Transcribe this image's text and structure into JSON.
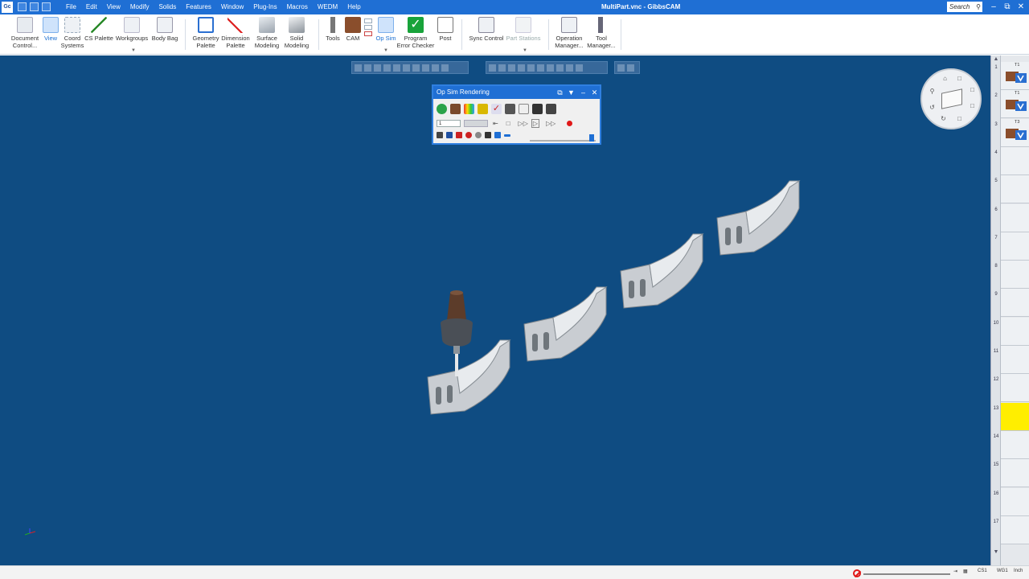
{
  "app": {
    "title": "MultiPart.vnc - GibbsCAM",
    "icon_label": "Gc",
    "search_placeholder": "Search"
  },
  "menu": [
    "File",
    "Edit",
    "View",
    "Modify",
    "Solids",
    "Features",
    "Window",
    "Plug-Ins",
    "Macros",
    "WEDM",
    "Help"
  ],
  "ribbon": {
    "document_control": "Document\nControl...",
    "view": "View",
    "coord_systems": "Coord\nSystems",
    "cs_palette": "CS Palette",
    "workgroups": "Workgroups",
    "body_bag": "Body Bag",
    "geometry_palette": "Geometry\nPalette",
    "dimension_palette": "Dimension\nPalette",
    "surface_modeling": "Surface\nModeling",
    "solid_modeling": "Solid\nModeling",
    "tools": "Tools",
    "cam": "CAM",
    "op_sim": "Op Sim",
    "program_error_checker": "Program\nError Checker",
    "post": "Post",
    "sync_control": "Sync Control",
    "part_stations": "Part Stations",
    "operation_manager": "Operation\nManager...",
    "tool_manager": "Tool\nManager..."
  },
  "opsim": {
    "title": "Op Sim Rendering",
    "frame_value": "1"
  },
  "ops_strip": {
    "numbers": [
      "1",
      "2",
      "3",
      "4",
      "5",
      "6",
      "7",
      "8",
      "9",
      "10",
      "11",
      "12",
      "13",
      "14",
      "15",
      "16",
      "17"
    ],
    "tool_tags": [
      "T1",
      "T1",
      "T3"
    ],
    "highlight_index": 12
  },
  "status": {
    "cs_label": "CS1",
    "wg_label": "WG1",
    "unit_label": "Inch"
  },
  "colors": {
    "titlebar": "#1f6fd4",
    "viewport": "#0f4c82",
    "highlight": "#ffee00",
    "record": "#e01818"
  }
}
